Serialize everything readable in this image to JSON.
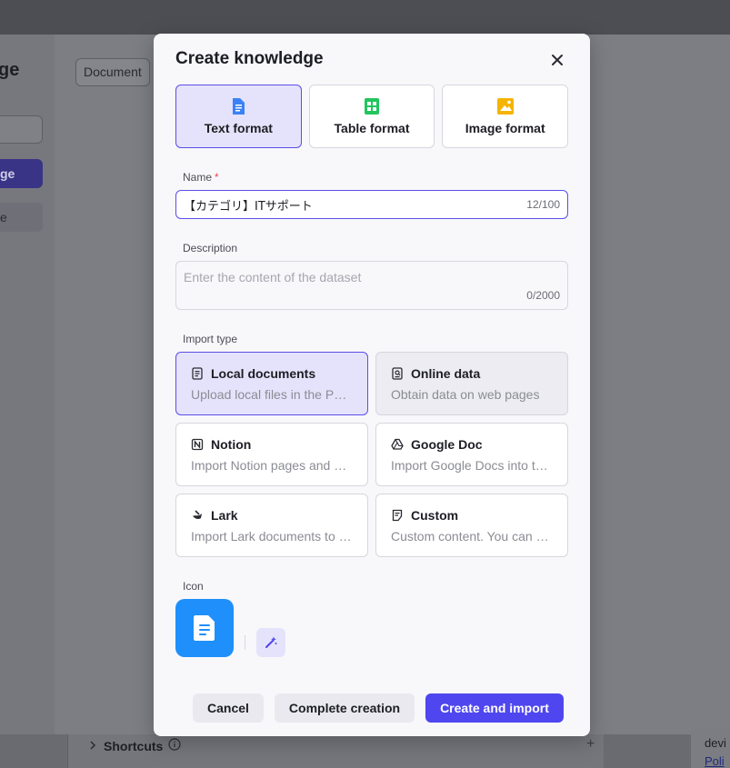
{
  "background": {
    "title": "ge",
    "primary_button": "ge",
    "secondary_button": "e",
    "filter_chip": "Document",
    "shortcuts_label": "Shortcuts",
    "shortcuts_add": "+",
    "right_text": "devi",
    "right_link": "Poli"
  },
  "modal": {
    "title": "Create knowledge",
    "close_icon": "close-icon",
    "formats": [
      {
        "label": "Text format",
        "icon": "text-file-icon",
        "color": "#3b82f6",
        "selected": true
      },
      {
        "label": "Table format",
        "icon": "table-icon",
        "color": "#22c55e",
        "selected": false
      },
      {
        "label": "Image format",
        "icon": "image-icon",
        "color": "#f5b400",
        "selected": false
      }
    ],
    "name": {
      "label": "Name",
      "required_mark": "*",
      "value": "【カテゴリ】ITサポート",
      "counter": "12/100"
    },
    "description": {
      "label": "Description",
      "placeholder": "Enter the content of the dataset",
      "value": "",
      "counter": "0/2000"
    },
    "import_type": {
      "label": "Import type",
      "options": [
        {
          "title": "Local documents",
          "desc": "Upload local files in the PDF, TXT, DOC, DOCX format",
          "icon": "document-icon",
          "selected": true
        },
        {
          "title": "Online data",
          "desc": "Obtain data on web pages",
          "icon": "web-page-icon",
          "selected": false
        },
        {
          "title": "Notion",
          "desc": "Import Notion pages and databases",
          "icon": "notion-icon",
          "selected": false
        },
        {
          "title": "Google Doc",
          "desc": "Import Google Docs into the knowledge base",
          "icon": "google-drive-icon",
          "selected": false
        },
        {
          "title": "Lark",
          "desc": "Import Lark documents to the knowledge base",
          "icon": "lark-icon",
          "selected": false
        },
        {
          "title": "Custom",
          "desc": "Custom content. You can enter data manually",
          "icon": "custom-doc-icon",
          "selected": false
        }
      ]
    },
    "icon_section": {
      "label": "Icon",
      "tile_color": "#1f8ffb",
      "magic_icon": "magic-wand-icon"
    },
    "buttons": {
      "cancel": "Cancel",
      "complete": "Complete creation",
      "create_import": "Create and import"
    },
    "accent_color": "#4f46ef"
  }
}
